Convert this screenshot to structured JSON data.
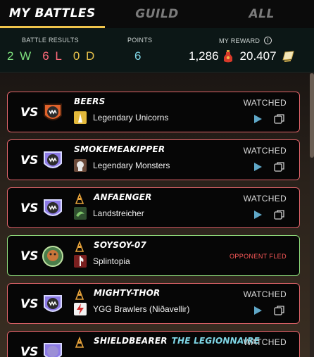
{
  "tabs": [
    {
      "label": "MY BATTLES",
      "active": true
    },
    {
      "label": "GUILD",
      "active": false
    },
    {
      "label": "ALL",
      "active": false
    }
  ],
  "stats": {
    "results_label": "BATTLE RESULTS",
    "wins": "2 W",
    "losses": "6 L",
    "draws": "0 D",
    "points_label": "POINTS",
    "points": "6",
    "reward_label": "MY REWARD",
    "reward_potion": "1,286",
    "reward_dec": "20.407"
  },
  "battles": [
    {
      "vs": "VS",
      "opponent": "BEERS",
      "guild": "Legendary Unicorns",
      "status": "WATCHED",
      "result": "loss",
      "avatar_color": "#e0622b",
      "guild_icon": "unicorn-icon"
    },
    {
      "vs": "VS",
      "opponent": "SMOKEMEAKIPPER",
      "guild": "Legendary Monsters",
      "status": "WATCHED",
      "result": "loss",
      "avatar_color": "#8c7ae6",
      "guild_icon": "monster-icon"
    },
    {
      "vs": "VS",
      "opponent": "ANFAENGER",
      "guild": "Landstreicher",
      "status": "WATCHED",
      "result": "loss",
      "avatar_color": "#8c7ae6",
      "guild_icon": "dragon-icon"
    },
    {
      "vs": "VS",
      "opponent": "SOYSOY-07",
      "guild": "Splintopia",
      "status": "OPPONENT FLED",
      "result": "win",
      "avatar_color": "#4a7d4a",
      "guild_icon": "axe-icon"
    },
    {
      "vs": "VS",
      "opponent": "MIGHTY-THOR",
      "guild": "YGG Brawlers (Niðavellir)",
      "status": "WATCHED",
      "result": "loss",
      "avatar_color": "#8c7ae6",
      "guild_icon": "lightning-icon"
    },
    {
      "vs": "VS",
      "opponent": "SHIELDBEARER",
      "title": "THE LEGIONNAIRE",
      "status": "WATCHED",
      "result": "loss",
      "avatar_color": "#8c7ae6"
    }
  ]
}
